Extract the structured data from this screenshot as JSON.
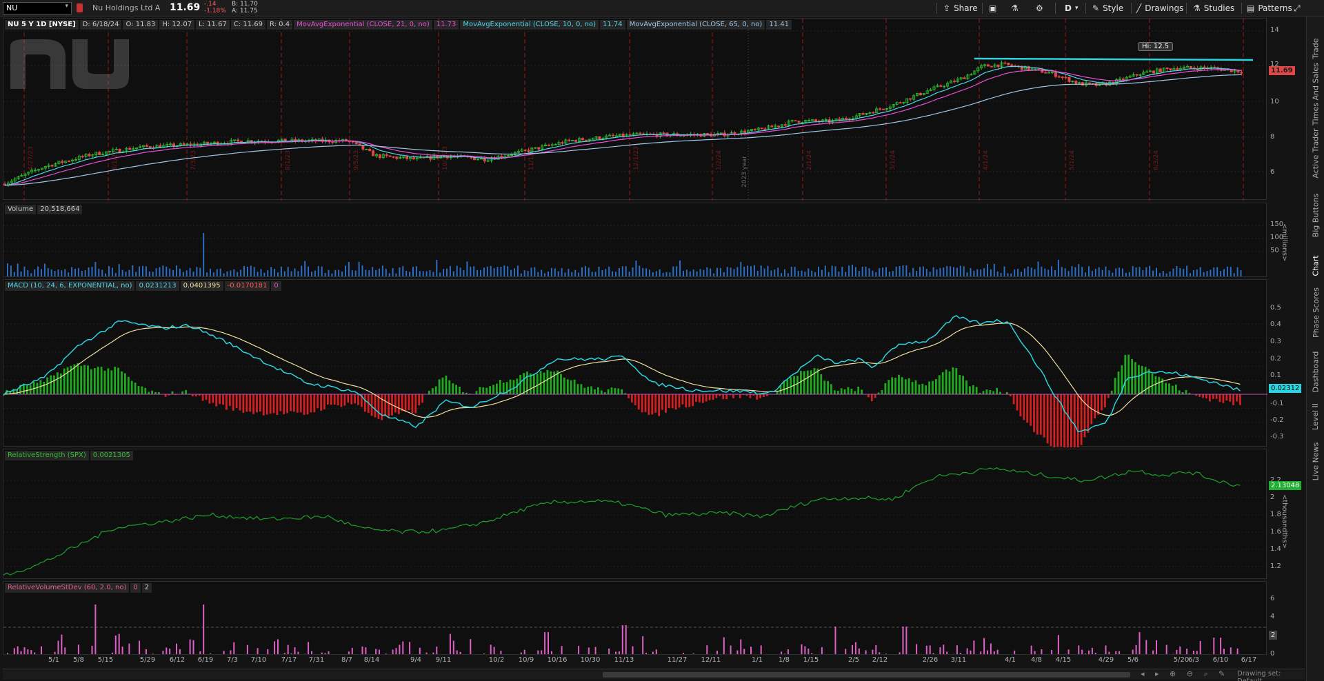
{
  "toolbar": {
    "symbol": "NU",
    "company": "Nu Holdings Ltd A",
    "last": "11.69",
    "change": "-.14",
    "change_pct": "-1.18%",
    "bid": "B: 11.70",
    "ask": "A: 11.75",
    "share_label": "Share",
    "aggregation": "D",
    "style_label": "Style",
    "drawings_label": "Drawings",
    "studies_label": "Studies",
    "patterns_label": "Patterns"
  },
  "price_pane": {
    "header": "NU 5 Y 1D [NYSE]",
    "date": "D: 6/18/24",
    "open": "O: 11.83",
    "high": "H: 12.07",
    "low": "L: 11.67",
    "close": "C: 11.69",
    "range": "R: 0.4",
    "studies": [
      {
        "label": "MovAvgExponential (CLOSE, 21, 0, no)",
        "value": "11.73",
        "color": "#e84fd6"
      },
      {
        "label": "MovAvgExponential (CLOSE, 10, 0, no)",
        "value": "11.74",
        "color": "#4fd6e8"
      },
      {
        "label": "MovAvgExponential (CLOSE, 65, 0, no)",
        "value": "11.41",
        "color": "#9fc7e8"
      }
    ],
    "axis_ticks": [
      "14",
      "12",
      "10",
      "8",
      "6"
    ],
    "last_price_tag": "11.69",
    "hi_bubble": "Hi: 12.5",
    "year_label": "2023 year",
    "event_dates": [
      "4/27/23",
      "6/1/23",
      "7/3/23",
      "8/1/23",
      "9/5/23",
      "10/3/23",
      "11/1/23",
      "12/1/23",
      "1/2/24",
      "2/1/24",
      "3/1/24",
      "4/1/24",
      "5/1/24",
      "6/3/24"
    ]
  },
  "volume_pane": {
    "label": "Volume",
    "value": "20,518,664",
    "axis_ticks": [
      "150",
      "100",
      "50"
    ],
    "unit": "<millions>"
  },
  "macd_pane": {
    "label": "MACD (10, 24, 6, EXPONENTIAL, no)",
    "value": "0.0231213",
    "avg": "0.0401395",
    "diff": "-0.0170181",
    "zero": "0",
    "axis_ticks": [
      "0.5",
      "0.4",
      "0.3",
      "0.2",
      "0.1",
      "-0.1",
      "-0.2",
      "-0.3"
    ],
    "last_tag": "0.02312"
  },
  "rs_pane": {
    "label": "RelativeStrength (SPX)",
    "value": "0.0021305",
    "axis_ticks": [
      "2.2",
      "2",
      "1.8",
      "1.6",
      "1.4",
      "1.2"
    ],
    "unit": "<thousandths>",
    "last_tag": "2.13048"
  },
  "rv_pane": {
    "label": "RelativeVolumeStDev (60, 2.0, no)",
    "v1": "0",
    "v2": "2",
    "axis_ticks": [
      "6",
      "4",
      "0"
    ],
    "mark_tag": "2"
  },
  "date_axis": [
    "5/1",
    "5/8",
    "5/15",
    "5/29",
    "6/12",
    "6/19",
    "7/3",
    "7/10",
    "7/17",
    "7/31",
    "8/7",
    "8/14",
    "9/4",
    "9/11",
    "10/2",
    "10/9",
    "10/16",
    "10/30",
    "11/13",
    "11/27",
    "12/11",
    "1/1",
    "1/8",
    "1/15",
    "2/5",
    "2/12",
    "2/26",
    "3/11",
    "4/1",
    "4/8",
    "4/15",
    "4/29",
    "5/6",
    "5/20",
    "6/3",
    "6/10",
    "6/17"
  ],
  "right_tabs": [
    "Trade",
    "Times And Sales",
    "Active Trader",
    "Big Buttons",
    "Chart",
    "Phase Scores",
    "Dashboard",
    "Level II",
    "Live News"
  ],
  "footer": {
    "drawing_set": "Drawing set: Default"
  },
  "colors": {
    "up": "#2fbf2f",
    "down": "#e04848",
    "accent": "#2ad4e0",
    "macd_hist_up": "#1faa1f",
    "macd_hist_down": "#d42020",
    "rs_line": "#1fa02f",
    "rv_bar": "#e060c8"
  }
}
